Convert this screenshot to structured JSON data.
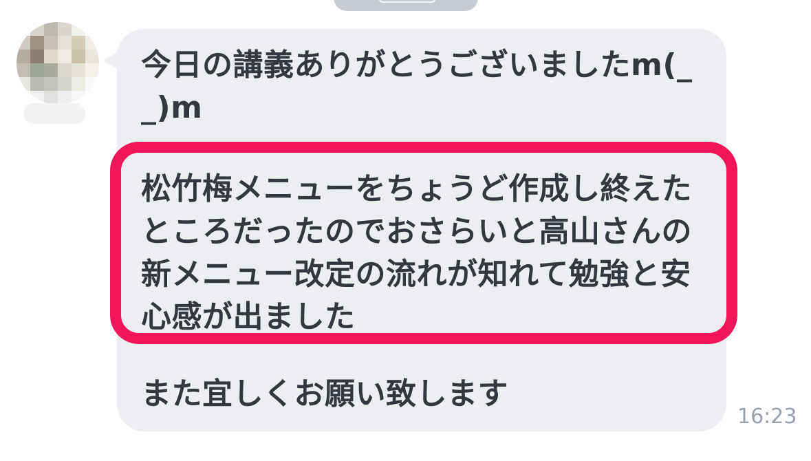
{
  "chat": {
    "message": {
      "paragraph1": [
        "今日の講義ありがとうございましたm(_",
        "_)m"
      ],
      "paragraph2": [
        "松竹梅メニューをちょうど作成し終えた",
        "ところだったのでおさらいと高山さんの",
        "新メニュー改定の流れが知れて勉強と安",
        "心感が出ました"
      ],
      "paragraph3": [
        "また宜しくお願い致します"
      ],
      "timestamp": "16:23"
    },
    "colors": {
      "bubble": "#edeef1",
      "text": "#333740",
      "highlight": "#f0155a",
      "timestamp": "#9aa0a8"
    }
  }
}
